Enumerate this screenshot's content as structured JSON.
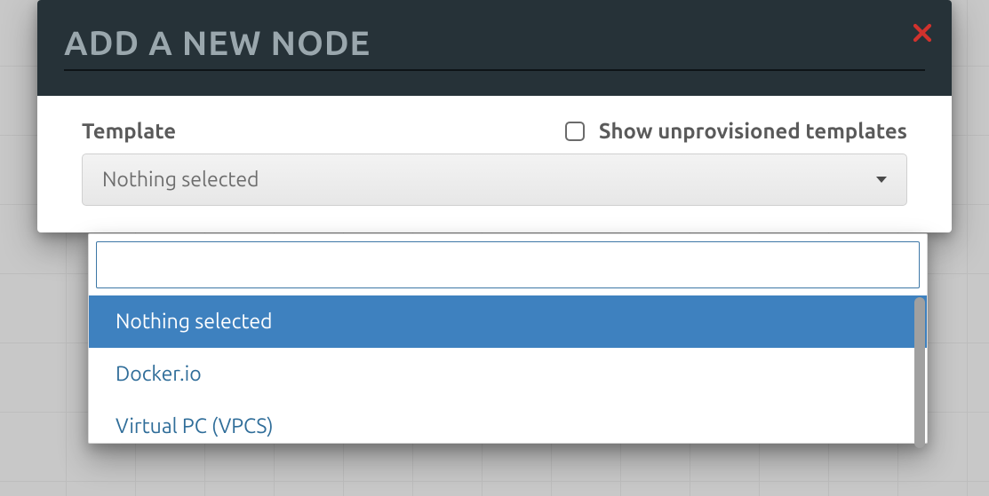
{
  "modal": {
    "title": "ADD A NEW NODE",
    "close_icon": "x-icon"
  },
  "template_field": {
    "label": "Template",
    "selected": "Nothing selected"
  },
  "unprovisioned_checkbox": {
    "label": "Show unprovisioned templates",
    "checked": false
  },
  "dropdown": {
    "search_value": "",
    "options": [
      {
        "label": "Nothing selected",
        "selected": true
      },
      {
        "label": "Docker.io",
        "selected": false
      },
      {
        "label": "Virtual PC (VPCS)",
        "selected": false
      }
    ]
  }
}
